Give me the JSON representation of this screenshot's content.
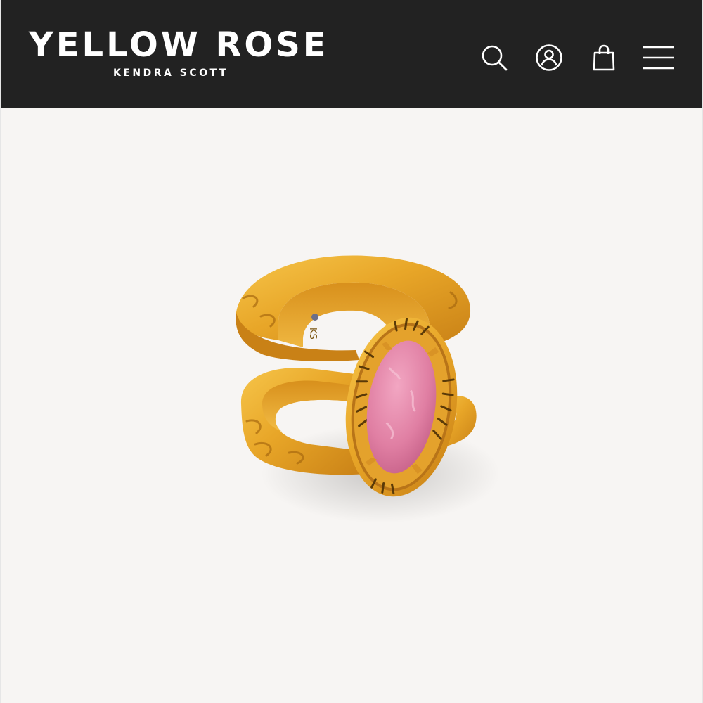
{
  "header": {
    "brand_name": "YELLOW ROSE",
    "brand_sub": "KENDRA SCOTT",
    "icons": [
      "search-icon",
      "account-icon",
      "shopping-bag-icon",
      "menu-icon"
    ]
  },
  "product": {
    "engraving": "KS"
  },
  "colors": {
    "header_bg": "#222222",
    "header_text": "#ffffff",
    "page_bg": "#f7f5f3",
    "gold": "#e3a326",
    "stone_pink": "#dd7fa2"
  }
}
